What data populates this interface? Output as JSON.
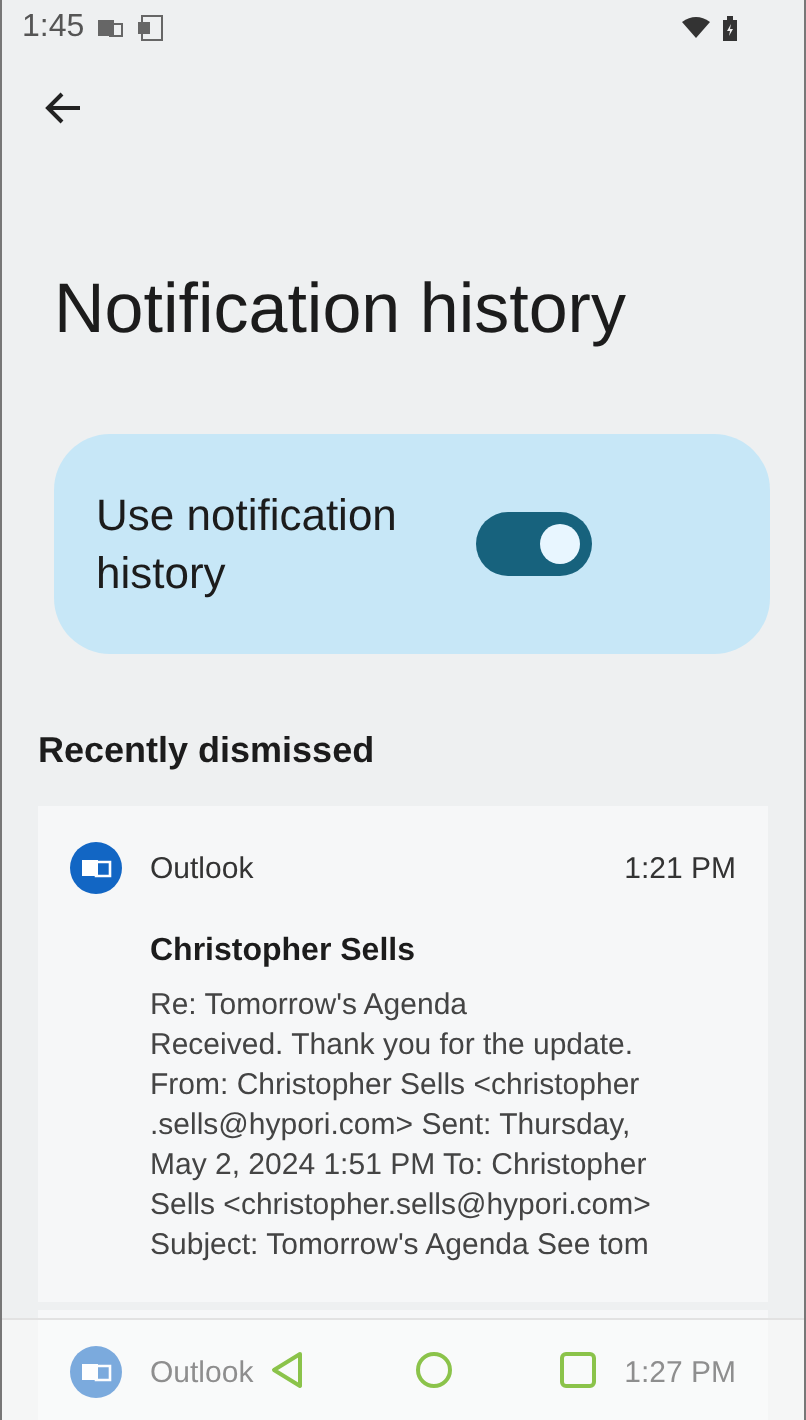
{
  "status_bar": {
    "time": "1:45"
  },
  "title": "Notification history",
  "setting": {
    "label": "Use notification history",
    "on": true
  },
  "section_title": "Recently dismissed",
  "notifications": [
    {
      "app": "Outlook",
      "time": "1:21 PM",
      "sender": "Christopher Sells",
      "lines": [
        "Re: Tomorrow's Agenda",
        "Received. Thank you for the update.",
        "From: Christopher Sells <christopher",
        ".sells@hypori.com> Sent: Thursday,",
        "May 2, 2024 1:51 PM To: Christopher",
        "Sells <christopher.sells@hypori.com>",
        "Subject: Tomorrow's Agenda See tom"
      ]
    },
    {
      "app": "Outlook",
      "time": "1:27 PM"
    }
  ]
}
